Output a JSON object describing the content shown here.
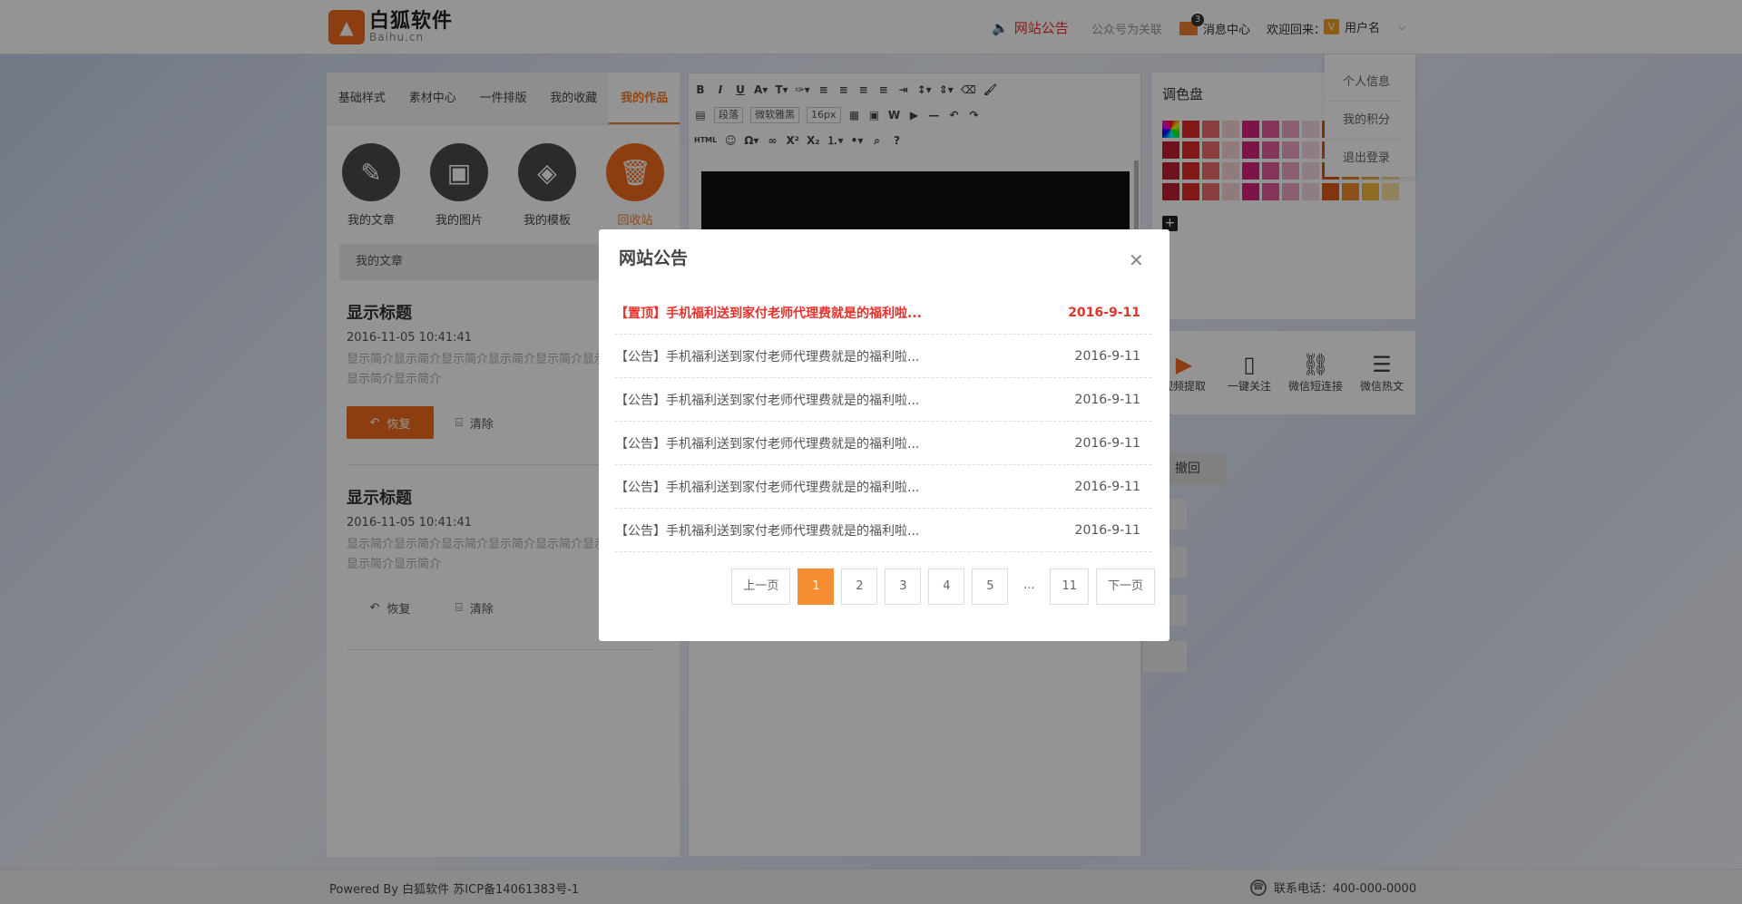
{
  "header": {
    "logo_cn": "白狐软件",
    "logo_en": "Baihu.cn",
    "notice": "网站公告",
    "wechat_link": "公众号为关联",
    "message_count": "3",
    "message_center": "消息中心",
    "welcome": "欢迎回来：",
    "username": "用户名",
    "user_menu": [
      "个人信息",
      "我的积分",
      "退出登录"
    ]
  },
  "left_panel": {
    "tabs": [
      "基础样式",
      "素材中心",
      "一件排版",
      "我的收藏",
      "我的作品"
    ],
    "categories": [
      "我的文章",
      "我的图片",
      "我的模板",
      "回收站"
    ],
    "breadcrumb": "我的文章",
    "articles": [
      {
        "title": "显示标题",
        "time": "2016-11-05 10:41:41",
        "desc": "显示简介显示简介显示简介显示简介显示简介显示简介显示简介显示简介",
        "restore": "恢复",
        "clear": "清除"
      },
      {
        "title": "显示标题",
        "time": "2016-11-05 10:41:41",
        "desc": "显示简介显示简介显示简介显示简介显示简介显示简介显示简介显示简介",
        "restore": "恢复",
        "clear": "清除"
      }
    ]
  },
  "editor": {
    "format_select": "段落",
    "font_select": "微软雅黑",
    "size_select": "16px"
  },
  "palette": {
    "title": "调色盘",
    "colors": [
      "#c02030",
      "#e02a2a",
      "#ee6b6b",
      "#f6d4d2",
      "#d6247a",
      "#e45c9a",
      "#f0a6c6",
      "#f7d8e6",
      "#e25a17",
      "#f28b2a",
      "#f6b73b",
      "#f8e0a0"
    ]
  },
  "tools": [
    "视频提取",
    "一键关注",
    "微信短连接",
    "微信热文"
  ],
  "undo_label": "撤回",
  "footer": {
    "left": "Powered By 白狐软件 苏ICP备14061383号-1",
    "right": "联系电话：400-000-0000"
  },
  "modal": {
    "title": "网站公告",
    "items": [
      {
        "text": "【置顶】手机福利送到家付老师代理费就是的福利啦...",
        "date": "2016-9-11",
        "pinned": true
      },
      {
        "text": "【公告】手机福利送到家付老师代理费就是的福利啦...",
        "date": "2016-9-11"
      },
      {
        "text": "【公告】手机福利送到家付老师代理费就是的福利啦...",
        "date": "2016-9-11"
      },
      {
        "text": "【公告】手机福利送到家付老师代理费就是的福利啦...",
        "date": "2016-9-11"
      },
      {
        "text": "【公告】手机福利送到家付老师代理费就是的福利啦...",
        "date": "2016-9-11"
      },
      {
        "text": "【公告】手机福利送到家付老师代理费就是的福利啦...",
        "date": "2016-9-11"
      }
    ],
    "pager": {
      "prev": "上一页",
      "pages": [
        "1",
        "2",
        "3",
        "4",
        "5"
      ],
      "dots": "...",
      "last": "11",
      "next": "下一页",
      "current": "1"
    }
  }
}
